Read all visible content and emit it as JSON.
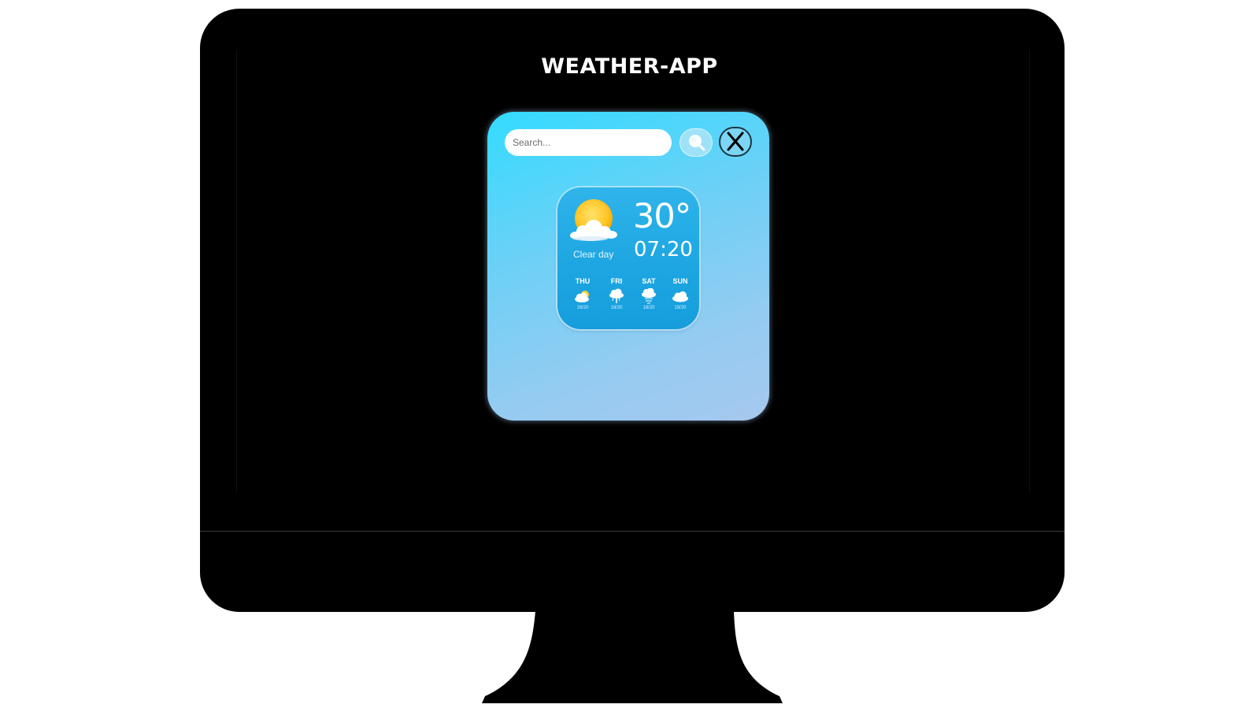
{
  "page": {
    "title": "WEATHER-APP"
  },
  "search": {
    "placeholder": "Search..."
  },
  "icons": {
    "search_button": "search-icon",
    "close_button": "close-icon",
    "current_weather": "sun-behind-cloud-icon"
  },
  "weather": {
    "temperature": "30°",
    "time": "07:20",
    "condition": "Clear day"
  },
  "forecast": [
    {
      "day": "THU",
      "icon": "partly-cloudy-icon",
      "range": "16/20"
    },
    {
      "day": "FRI",
      "icon": "rain-cloud-icon",
      "range": "18/20"
    },
    {
      "day": "SAT",
      "icon": "snow-cloud-icon",
      "range": "18/20"
    },
    {
      "day": "SUN",
      "icon": "cloud-icon",
      "range": "19/20"
    }
  ],
  "colors": {
    "card_gradient_start": "#33dbff",
    "card_gradient_end": "#a6c8ee",
    "widget_background": "#1ea6e2",
    "title_text": "#ffffff"
  }
}
